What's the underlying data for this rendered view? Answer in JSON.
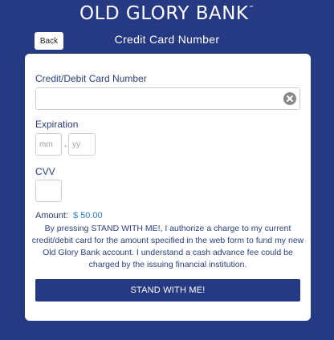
{
  "header": {
    "brand": "OLD GLORY BANK",
    "brand_mark": "™",
    "back_label": "Back",
    "title": "Credit Card Number"
  },
  "form": {
    "card_number_label": "Credit/Debit Card Number",
    "card_number_value": "",
    "expiration_label": "Expiration",
    "month_placeholder": "mm",
    "year_placeholder": "yy",
    "date_separator": ".",
    "cvv_label": "CVV",
    "amount_label": "Amount:",
    "amount_value": "$ 50.00",
    "disclaimer": "By pressing STAND WITH ME!, I authorize a charge to my current credit/debit card for the amount specified in the web form to fund my new Old Glory Bank account. I understand a cash advance fee could be charged by the issuing financial institution.",
    "submit_label": "STAND WITH ME!"
  },
  "icons": {
    "clear": "clear-icon"
  },
  "colors": {
    "background": "#253a82",
    "card": "#ffffff",
    "label_text": "#2a3f7e",
    "amount": "#2c7fc4",
    "button": "#253a82"
  }
}
